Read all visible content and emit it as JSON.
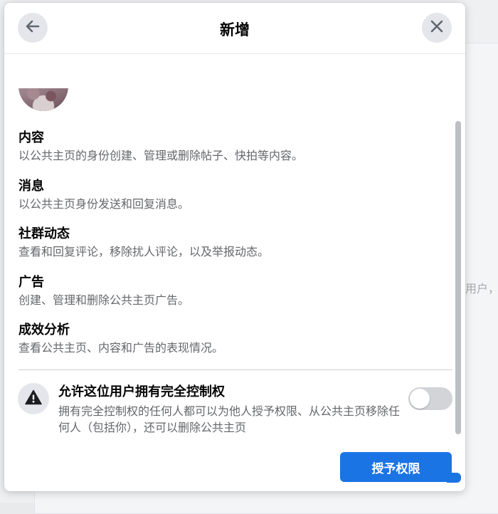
{
  "background": {
    "partial_text": "用户，"
  },
  "dialog": {
    "title": "新增",
    "back_icon": "arrow-left-icon",
    "close_icon": "close-icon"
  },
  "permissions": [
    {
      "title": "内容",
      "description": "以公共主页的身份创建、管理或删除帖子、快拍等内容。"
    },
    {
      "title": "消息",
      "description": "以公共主页身份发送和回复消息。"
    },
    {
      "title": "社群动态",
      "description": "查看和回复评论，移除扰人评论，以及举报动态。"
    },
    {
      "title": "广告",
      "description": "创建、管理和删除公共主页广告。"
    },
    {
      "title": "成效分析",
      "description": "查看公共主页、内容和广告的表现情况。"
    }
  ],
  "full_control": {
    "icon": "warning-icon",
    "title": "允许这位用户拥有完全控制权",
    "description": "拥有完全控制权的任何人都可以为他人授予权限、从公共主页移除任何人（包括你），还可以删除公共主页",
    "toggle_on": false
  },
  "actions": {
    "grant_label": "授予权限"
  },
  "colors": {
    "primary": "#1b74e4",
    "secondary_text": "#65676b",
    "icon_bg": "#e4e6eb"
  }
}
